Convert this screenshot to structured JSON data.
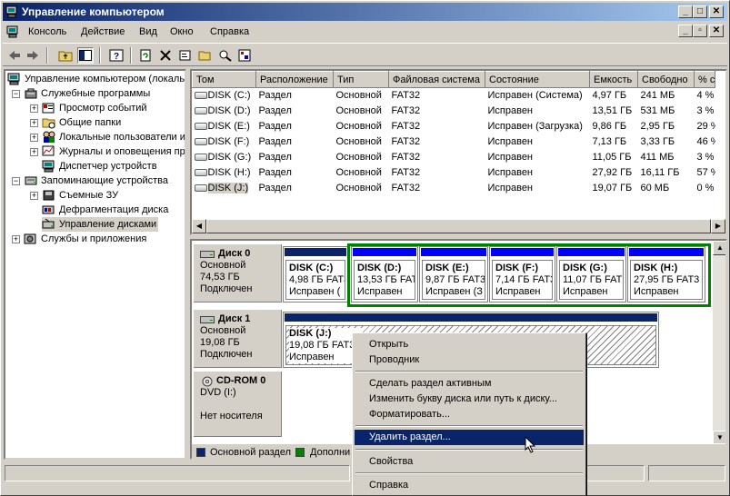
{
  "window": {
    "title": "Управление компьютером"
  },
  "menu": [
    "Консоль",
    "Действие",
    "Вид",
    "Окно",
    "Справка"
  ],
  "tree": {
    "root": "Управление компьютером (локаль",
    "items": [
      "Служебные программы",
      "Просмотр событий",
      "Общие папки",
      "Локальные пользователи и",
      "Журналы и оповещения пр",
      "Диспетчер устройств",
      "Запоминающие устройства",
      "Съемные ЗУ",
      "Дефрагментация диска",
      "Управление дисками",
      "Службы и приложения"
    ]
  },
  "volumes": {
    "columns": [
      "Том",
      "Расположение",
      "Тип",
      "Файловая система",
      "Состояние",
      "Емкость",
      "Свободно",
      "% с"
    ],
    "rows": [
      [
        "DISK (C:)",
        "Раздел",
        "Основной",
        "FAT32",
        "Исправен (Система)",
        "4,97 ГБ",
        "241 МБ",
        "4 %"
      ],
      [
        "DISK (D:)",
        "Раздел",
        "Основной",
        "FAT32",
        "Исправен",
        "13,51 ГБ",
        "531 МБ",
        "3 %"
      ],
      [
        "DISK (E:)",
        "Раздел",
        "Основной",
        "FAT32",
        "Исправен (Загрузка)",
        "9,86 ГБ",
        "2,95 ГБ",
        "29 %"
      ],
      [
        "DISK (F:)",
        "Раздел",
        "Основной",
        "FAT32",
        "Исправен",
        "7,13 ГБ",
        "3,33 ГБ",
        "46 %"
      ],
      [
        "DISK (G:)",
        "Раздел",
        "Основной",
        "FAT32",
        "Исправен",
        "11,05 ГБ",
        "411 МБ",
        "3 %"
      ],
      [
        "DISK (H:)",
        "Раздел",
        "Основной",
        "FAT32",
        "Исправен",
        "27,92 ГБ",
        "16,11 ГБ",
        "57 %"
      ],
      [
        "DISK (J:)",
        "Раздел",
        "Основной",
        "FAT32",
        "Исправен",
        "19,07 ГБ",
        "60 МБ",
        "0 %"
      ]
    ]
  },
  "disks": [
    {
      "name": "Диск 0",
      "type": "Основной",
      "size": "74,53 ГБ",
      "status": "Подключен",
      "parts": [
        {
          "name": "DISK (C:)",
          "size": "4,98 ГБ FAT32",
          "status": "Исправен ("
        },
        {
          "name": "DISK (D:)",
          "size": "13,53 ГБ FAT",
          "status": "Исправен"
        },
        {
          "name": "DISK (E:)",
          "size": "9,87 ГБ FAT3",
          "status": "Исправен (З"
        },
        {
          "name": "DISK (F:)",
          "size": "7,14 ГБ FAT3",
          "status": "Исправен"
        },
        {
          "name": "DISK (G:)",
          "size": "11,07 ГБ FAT",
          "status": "Исправен"
        },
        {
          "name": "DISK (H:)",
          "size": "27,95 ГБ FAT3",
          "status": "Исправен"
        }
      ]
    },
    {
      "name": "Диск 1",
      "type": "Основной",
      "size": "19,08 ГБ",
      "status": "Подключен",
      "parts": [
        {
          "name": "DISK (J:)",
          "size": "19,08 ГБ FAT32",
          "status": "Исправен"
        }
      ]
    },
    {
      "name": "CD-ROM 0",
      "type": "DVD (I:)",
      "size": "",
      "status": "Нет носителя",
      "parts": []
    }
  ],
  "legend": {
    "primary": "Основной раздел",
    "extended": "Дополни",
    "primary_color": "#0a246a",
    "extended_color": "#008000"
  },
  "context_menu": {
    "items": [
      "Открыть",
      "Проводник",
      "Сделать раздел активным",
      "Изменить букву диска или путь к диску...",
      "Форматировать...",
      "Удалить раздел...",
      "Свойства",
      "Справка"
    ],
    "highlighted": "Удалить раздел..."
  }
}
